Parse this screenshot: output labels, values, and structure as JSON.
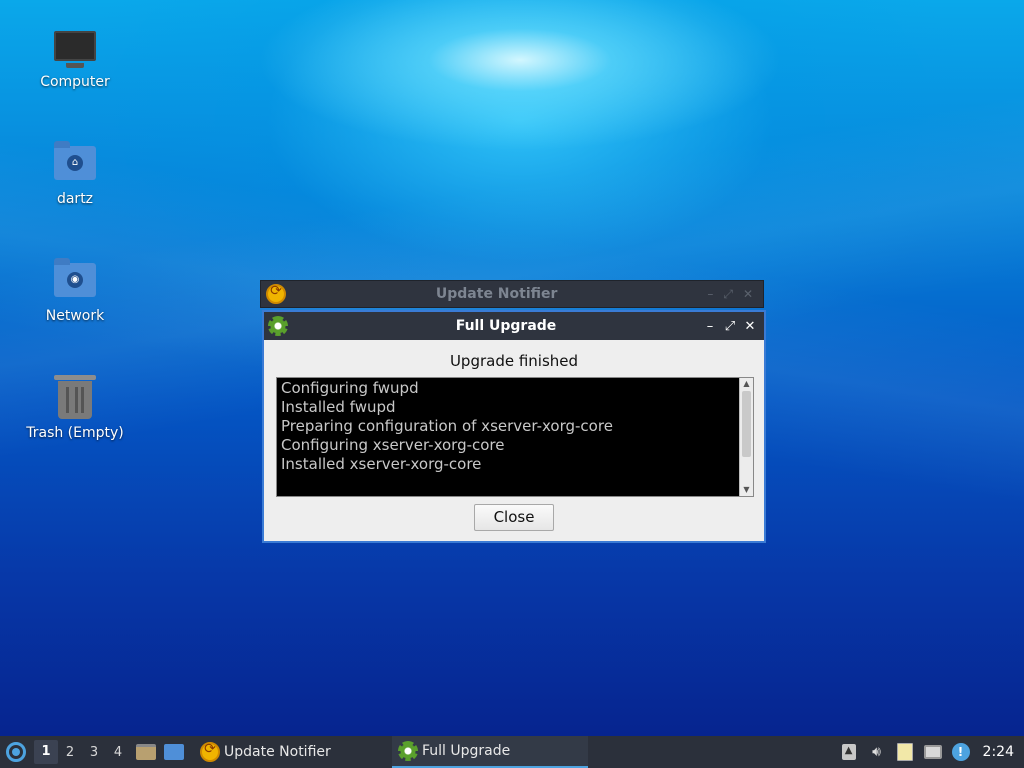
{
  "desktop": {
    "icons": [
      {
        "label": "Computer",
        "icon": "computer-icon"
      },
      {
        "label": "dartz",
        "icon": "home-folder-icon"
      },
      {
        "label": "Network",
        "icon": "network-folder-icon"
      },
      {
        "label": "Trash (Empty)",
        "icon": "trash-icon"
      }
    ]
  },
  "back_window": {
    "title": "Update Notifier",
    "controls": [
      "–",
      "⤢",
      "✕"
    ]
  },
  "window": {
    "title": "Full Upgrade",
    "controls": {
      "minimize": "–",
      "maximize": "⤢",
      "close": "✕"
    },
    "heading": "Upgrade finished",
    "log_lines": [
      "Configuring fwupd",
      "Installed fwupd",
      "Preparing configuration of xserver-xorg-core",
      "Configuring xserver-xorg-core",
      "Installed xserver-xorg-core"
    ],
    "close_label": "Close"
  },
  "taskbar": {
    "workspaces": [
      "1",
      "2",
      "3",
      "4"
    ],
    "active_workspace": "1",
    "tasks": [
      {
        "label": "Update Notifier",
        "icon": "update-notifier-icon"
      },
      {
        "label": "Full Upgrade",
        "icon": "gear-icon",
        "active": true
      }
    ],
    "clock": "2:24"
  },
  "colors": {
    "titlebar": "#2f343f",
    "accent": "#3a7bd5",
    "taskbar": "#2b303b"
  }
}
